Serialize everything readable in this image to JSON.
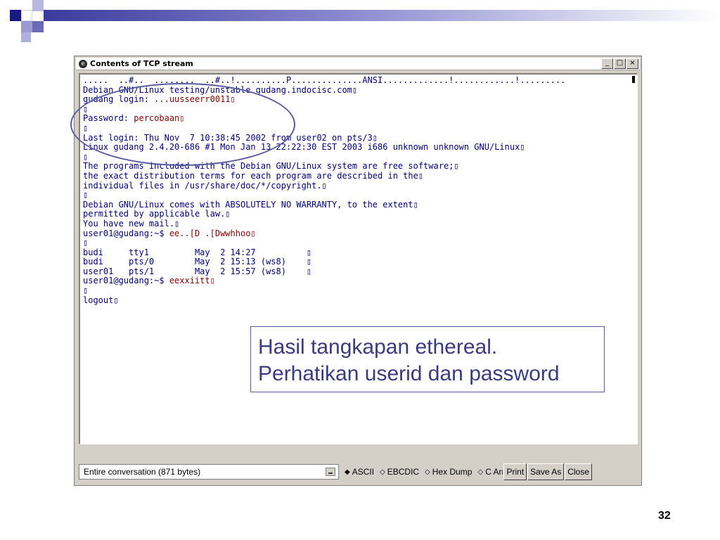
{
  "window": {
    "title": "Contents of TCP stream",
    "title_icon": "ethereal-icon",
    "buttons": [
      "_",
      "□",
      "×"
    ]
  },
  "stream": {
    "lines": [
      {
        "t": ".....  ..#..  ........  ..#..!..........P..............ANSI.............!............!.........",
        "c": "srv"
      },
      {
        "t": "Debian GNU/Linux testing/unstable gudang.indocisc.com▯",
        "c": "srv"
      },
      {
        "t": "gudang login: ",
        "c": "srv",
        "t2": "...uusseerr0011▯",
        "c2": "cli"
      },
      {
        "t": "▯",
        "c": "srv"
      },
      {
        "t": "Password: ",
        "c": "srv",
        "t2": "percobaan▯",
        "c2": "cli"
      },
      {
        "t": "▯",
        "c": "srv"
      },
      {
        "t": "Last login: Thu Nov  7 10:38:45 2002 from user02 on pts/3▯",
        "c": "srv"
      },
      {
        "t": "Linux gudang 2.4.20-686 #1 Mon Jan 13 22:22:30 EST 2003 i686 unknown unknown GNU/Linux▯",
        "c": "srv"
      },
      {
        "t": "▯",
        "c": "srv"
      },
      {
        "t": "The programs included with the Debian GNU/Linux system are free software;▯",
        "c": "srv"
      },
      {
        "t": "the exact distribution terms for each program are described in the▯",
        "c": "srv"
      },
      {
        "t": "individual files in /usr/share/doc/*/copyright.▯",
        "c": "srv"
      },
      {
        "t": "▯",
        "c": "srv"
      },
      {
        "t": "Debian GNU/Linux comes with ABSOLUTELY NO WARRANTY, to the extent▯",
        "c": "srv"
      },
      {
        "t": "permitted by applicable law.▯",
        "c": "srv"
      },
      {
        "t": "You have new mail.▯",
        "c": "srv"
      },
      {
        "t": "user01@gudang:~$ ",
        "c": "srv",
        "t2": "ee..[D .[Dwwhhoo▯",
        "c2": "cli"
      },
      {
        "t": "▯",
        "c": "srv"
      },
      {
        "t": "budi     tty1         May  2 14:27          ▯",
        "c": "srv"
      },
      {
        "t": "budi     pts/0        May  2 15:13 (ws8)    ▯",
        "c": "srv"
      },
      {
        "t": "user01   pts/1        May  2 15:57 (ws8)    ▯",
        "c": "srv"
      },
      {
        "t": "user01@gudang:~$ ",
        "c": "srv",
        "t2": "eexxiitt▯",
        "c2": "cli"
      },
      {
        "t": "▯",
        "c": "srv"
      },
      {
        "t": "logout▯",
        "c": "srv"
      }
    ]
  },
  "controls": {
    "conversation": "Entire conversation (871 bytes)",
    "radios": [
      {
        "label": "ASCII",
        "selected": true
      },
      {
        "label": "EBCDIC",
        "selected": false
      },
      {
        "label": "Hex Dump",
        "selected": false
      },
      {
        "label": "C Arrays",
        "selected": false
      }
    ],
    "print": "Print",
    "save_as": "Save As",
    "close": "Close"
  },
  "annotation": {
    "line1": "Hasil tangkapan ethereal.",
    "line2": "Perhatikan userid dan password"
  },
  "page_number": "32",
  "colors": {
    "server_text": "#000080",
    "client_text": "#8b0000",
    "annotation_text": "#3a3a80",
    "accent": "#3b3b9e"
  }
}
